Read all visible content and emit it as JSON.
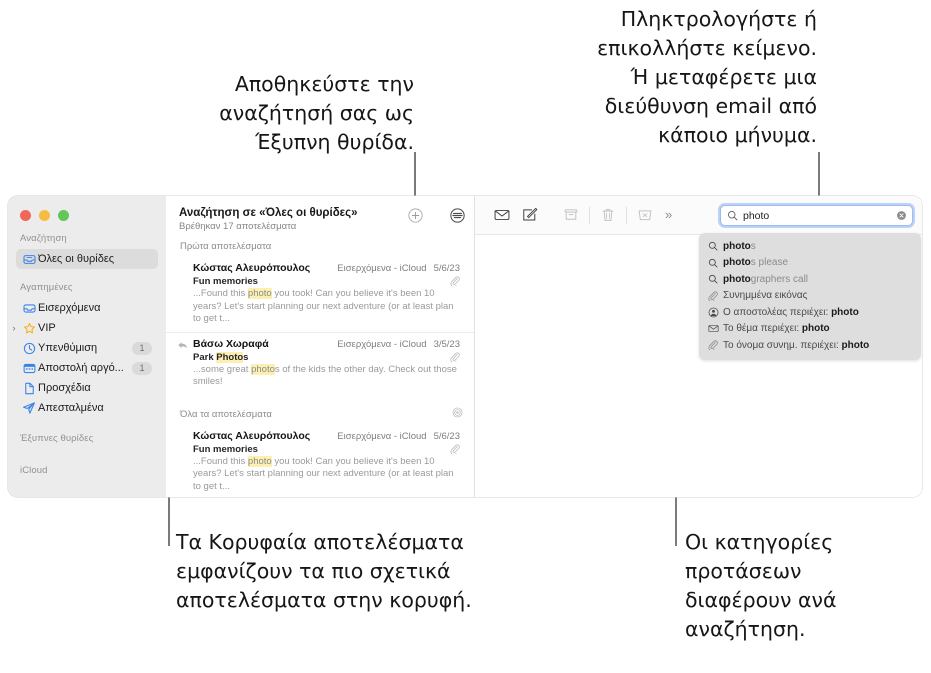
{
  "callouts": {
    "save_search": "Αποθηκεύστε την\nαναζήτησή σας ως\nΈξυπνη θυρίδα.",
    "type_paste": "Πληκτρολογήστε ή\nεπικολλήστε κείμενο.\nΉ μεταφέρετε μια\nδιεύθυνση email από\nκάποιο μήνυμα.",
    "top_results": "Τα Κορυφαία αποτελέσματα\nεμφανίζουν τα πιο σχετικά\nαποτελέσματα στην κορυφή.",
    "categories": "Οι κατηγορίες\nπροτάσεων\nδιαφέρουν ανά\nαναζήτηση."
  },
  "sidebar": {
    "sections": [
      {
        "header": "Αναζήτηση",
        "items": [
          {
            "label": "Όλες οι θυρίδες",
            "icon": "all-mailboxes-icon",
            "selected": true,
            "badge": ""
          }
        ]
      },
      {
        "header": "Αγαπημένες",
        "items": [
          {
            "label": "Εισερχόμενα",
            "icon": "inbox-icon",
            "selected": false,
            "badge": ""
          },
          {
            "label": "VIP",
            "icon": "star-icon",
            "selected": false,
            "badge": "",
            "disclosure": "›"
          },
          {
            "label": "Υπενθύμιση",
            "icon": "clock-icon",
            "selected": false,
            "badge": "1"
          },
          {
            "label": "Αποστολή αργό...",
            "icon": "calendar-icon",
            "selected": false,
            "badge": "1"
          },
          {
            "label": "Προσχέδια",
            "icon": "drafts-icon",
            "selected": false,
            "badge": ""
          },
          {
            "label": "Απεσταλμένα",
            "icon": "sent-icon",
            "selected": false,
            "badge": ""
          }
        ]
      },
      {
        "header": "Έξυπνες θυρίδες",
        "items": []
      },
      {
        "header": "iCloud",
        "items": []
      }
    ]
  },
  "list": {
    "title": "Αναζήτηση σε «Όλες οι θυρίδες»",
    "subtitle": "Βρέθηκαν 17 αποτελέσματα",
    "add_button": "add-smart-mailbox-icon",
    "filter_button": "filter-icon",
    "sections": [
      {
        "label": "Πρώτα αποτελέσματα",
        "messages": [
          {
            "from": "Κώστας Αλευρόπουλος",
            "mailbox": "Εισερχόμενα - iCloud",
            "date": "5/6/23",
            "subject_pre": "Fun memories",
            "subject_hl": "",
            "subject_post": "",
            "body_pre": "...Found this ",
            "body_hl": "photo",
            "body_post": " you took! Can you believe it's been 10 years? Let's start planning our next adventure (or at least plan to get t...",
            "replied": false,
            "attachment": true
          },
          {
            "from": "Βάσω Χωραφά",
            "mailbox": "Εισερχόμενα - iCloud",
            "date": "3/5/23",
            "subject_pre": "Park ",
            "subject_hl": "Photo",
            "subject_post": "s",
            "body_pre": "...some great ",
            "body_hl": "photo",
            "body_post": "s of the kids the other day. Check out those smiles!",
            "replied": true,
            "attachment": true
          }
        ]
      },
      {
        "label": "Όλα τα αποτελέσματα",
        "section_icon": "fingerprint-icon",
        "messages": [
          {
            "from": "Κώστας Αλευρόπουλος",
            "mailbox": "Εισερχόμενα - iCloud",
            "date": "5/6/23",
            "subject_pre": "Fun memories",
            "subject_hl": "",
            "subject_post": "",
            "body_pre": "...Found this ",
            "body_hl": "photo",
            "body_post": " you took! Can you believe it's been 10 years? Let's start planning our next adventure (or at least plan to get t...",
            "replied": false,
            "attachment": true
          }
        ]
      }
    ]
  },
  "toolbar": {
    "buttons": [
      {
        "name": "mark-unread-icon"
      },
      {
        "name": "compose-icon"
      },
      {
        "name": "archive-icon"
      },
      {
        "name": "delete-icon"
      },
      {
        "name": "junk-icon"
      }
    ],
    "overflow": "»"
  },
  "search": {
    "value": "photo",
    "icon": "search-icon",
    "clear": "clear-icon"
  },
  "suggestions": [
    {
      "icon": "search-icon",
      "pre": "photo",
      "post": "s",
      "style": "token"
    },
    {
      "icon": "search-icon",
      "pre": "photo",
      "post": "s please",
      "style": "token"
    },
    {
      "icon": "search-icon",
      "pre": "photo",
      "post": "graphers call",
      "style": "token"
    },
    {
      "icon": "paperclip-icon",
      "pre": "",
      "label": "Συνημμένα εικόνας",
      "style": "plain"
    },
    {
      "icon": "person-icon",
      "pre": "",
      "label": "Ο αποστολέας περιέχει: ",
      "bold": "photo",
      "style": "labeled"
    },
    {
      "icon": "envelope-icon",
      "pre": "",
      "label": "Το θέμα περιέχει: ",
      "bold": "photo",
      "style": "labeled"
    },
    {
      "icon": "paperclip-icon",
      "pre": "",
      "label": "Το όνομα συνημ. περιέχει: ",
      "bold": "photo",
      "style": "labeled"
    }
  ],
  "colors": {
    "accent_blue": "#3b82e8",
    "highlight": "#fbf0b2",
    "window_bg": "#ffffff",
    "sidebar_bg": "#ececec",
    "suggest_bg": "#dededf"
  }
}
